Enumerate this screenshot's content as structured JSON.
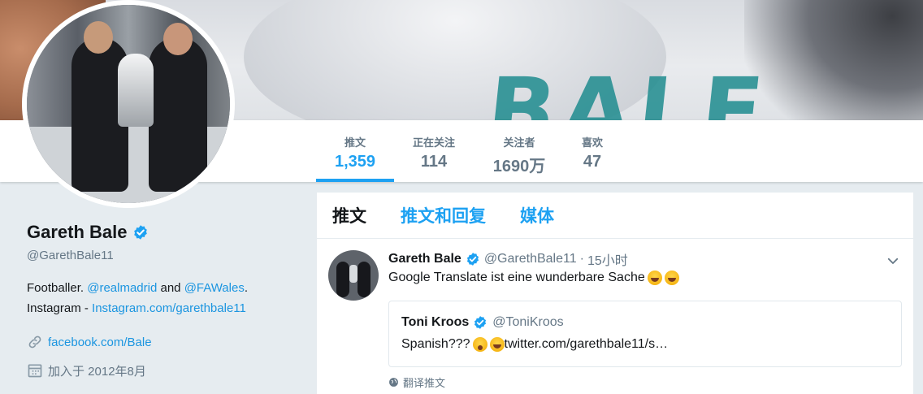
{
  "banner": {
    "shirt_text": "BALE"
  },
  "nav": {
    "stats": [
      {
        "label": "推文",
        "value": "1,359",
        "active": true
      },
      {
        "label": "正在关注",
        "value": "114",
        "active": false
      },
      {
        "label": "关注者",
        "value": "1690万",
        "active": false
      },
      {
        "label": "喜欢",
        "value": "47",
        "active": false
      }
    ]
  },
  "profile": {
    "name": "Gareth Bale",
    "handle": "@GarethBale11",
    "bio_prefix": "Footballer. ",
    "bio_link1": "@realmadrid",
    "bio_and": " and ",
    "bio_link2": "@FAWales",
    "bio_period": ".",
    "bio_instagram_label": "Instagram - ",
    "bio_instagram_link": "Instagram.com/garethbale11",
    "website": "facebook.com/Bale",
    "joined": "加入于 2012年8月"
  },
  "timeline": {
    "tabs": [
      {
        "label": "推文",
        "active": true
      },
      {
        "label": "推文和回复",
        "active": false
      },
      {
        "label": "媒体",
        "active": false
      }
    ],
    "tweet": {
      "name": "Gareth Bale",
      "handle": "@GarethBale11",
      "separator": "·",
      "time": "15小时",
      "text": "Google Translate ist eine wunderbare Sache ",
      "quote": {
        "name": "Toni Kroos",
        "handle": "@ToniKroos",
        "text_prefix": "Spanish???",
        "text_link": " twitter.com/garethbale11/s…"
      },
      "translate_label": "翻译推文"
    }
  },
  "colors": {
    "accent": "#1da1f2",
    "link": "#1b95e0",
    "muted": "#657786",
    "text": "#14171a",
    "page_bg": "#e6ecf0"
  },
  "icons": [
    "verified-badge-icon",
    "link-icon",
    "calendar-icon",
    "chevron-down-icon",
    "globe-icon",
    "laughing-emoji-icon",
    "flushed-emoji-icon"
  ]
}
